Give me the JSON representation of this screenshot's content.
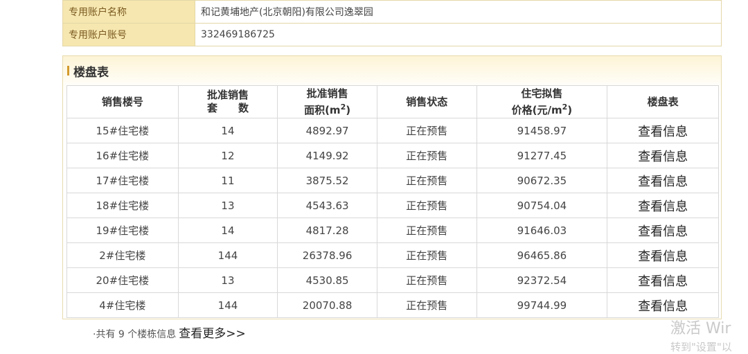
{
  "account": {
    "rows": [
      {
        "label": "专用账户名称",
        "value": "和记黄埔地产(北京朝阳)有限公司逸翠园"
      },
      {
        "label": "专用账户账号",
        "value": "332469186725"
      }
    ]
  },
  "section": {
    "title": "楼盘表"
  },
  "table": {
    "headers": {
      "building": "销售楼号",
      "units_l1": "批准销售",
      "units_l2": "套　　数",
      "area_l1": "批准销售",
      "area_l2": "面积(m",
      "area_sup": "2",
      "area_end": ")",
      "status": "销售状态",
      "price_l1": "住宅拟售",
      "price_l2": "价格(元/m",
      "price_sup": "2",
      "price_end": ")",
      "table_link": "楼盘表"
    },
    "rows": [
      {
        "building": "15#住宅楼",
        "units": "14",
        "area": "4892.97",
        "status": "正在预售",
        "price": "91458.97",
        "link": "查看信息"
      },
      {
        "building": "16#住宅楼",
        "units": "12",
        "area": "4149.92",
        "status": "正在预售",
        "price": "91277.45",
        "link": "查看信息"
      },
      {
        "building": "17#住宅楼",
        "units": "11",
        "area": "3875.52",
        "status": "正在预售",
        "price": "90672.35",
        "link": "查看信息"
      },
      {
        "building": "18#住宅楼",
        "units": "13",
        "area": "4543.63",
        "status": "正在预售",
        "price": "90754.04",
        "link": "查看信息"
      },
      {
        "building": "19#住宅楼",
        "units": "14",
        "area": "4817.28",
        "status": "正在预售",
        "price": "91646.03",
        "link": "查看信息"
      },
      {
        "building": "2#住宅楼",
        "units": "144",
        "area": "26378.96",
        "status": "正在预售",
        "price": "96465.86",
        "link": "查看信息"
      },
      {
        "building": "20#住宅楼",
        "units": "13",
        "area": "4530.85",
        "status": "正在预售",
        "price": "92372.54",
        "link": "查看信息"
      },
      {
        "building": "4#住宅楼",
        "units": "144",
        "area": "20070.88",
        "status": "正在预售",
        "price": "99744.99",
        "link": "查看信息"
      }
    ]
  },
  "footer": {
    "summary": "·共有 9 个楼栋信息",
    "more_link": "查看更多>>"
  },
  "watermark": {
    "line1": "激活 Wir",
    "line2": "转到\"设置\"以"
  }
}
